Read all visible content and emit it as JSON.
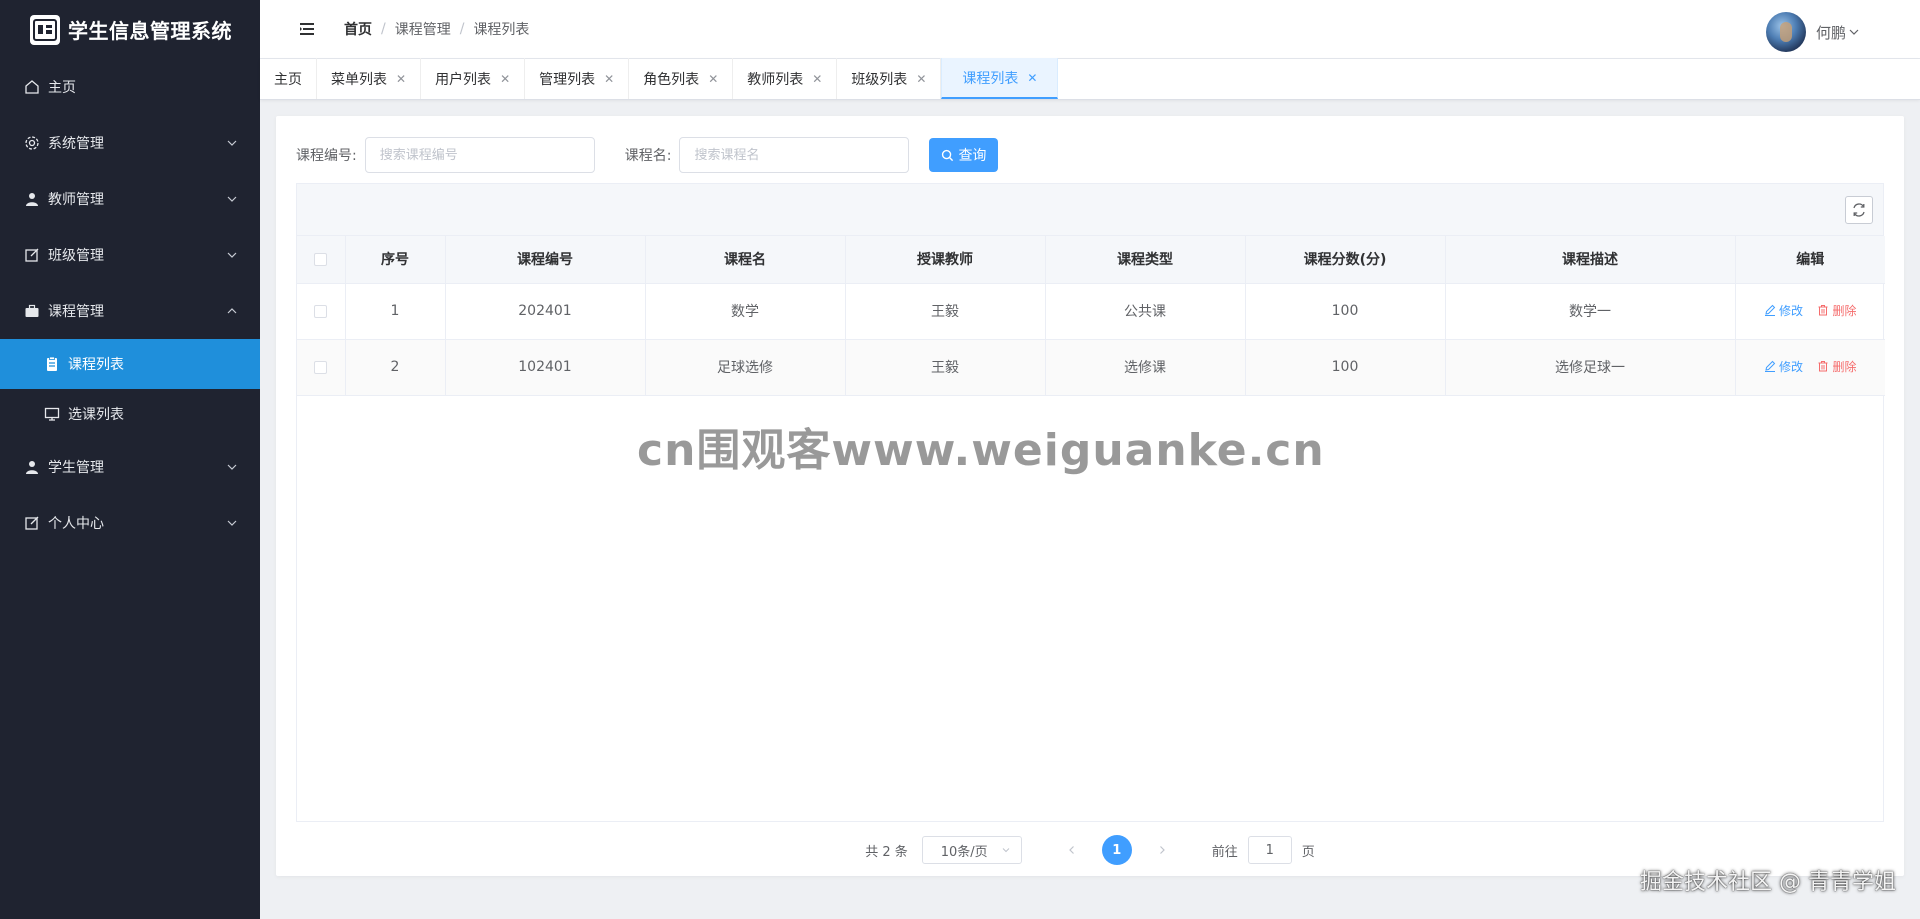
{
  "app": {
    "title": "学生信息管理系统"
  },
  "sidebar": {
    "items": [
      {
        "label": "主页",
        "icon": "home-icon"
      },
      {
        "label": "系统管理",
        "icon": "gear-icon"
      },
      {
        "label": "教师管理",
        "icon": "user-icon"
      },
      {
        "label": "班级管理",
        "icon": "edit-icon"
      },
      {
        "label": "课程管理",
        "icon": "briefcase-icon",
        "expanded": true,
        "children": [
          {
            "label": "课程列表",
            "icon": "document-icon",
            "active": true
          },
          {
            "label": "选课列表",
            "icon": "monitor-icon"
          }
        ]
      },
      {
        "label": "学生管理",
        "icon": "user-icon"
      },
      {
        "label": "个人中心",
        "icon": "edit-icon"
      }
    ]
  },
  "header": {
    "breadcrumb": [
      "首页",
      "课程管理",
      "课程列表"
    ],
    "breadcrumb_sep": "/",
    "user_name": "何鹏"
  },
  "tabs": [
    {
      "label": "主页",
      "closable": false
    },
    {
      "label": "菜单列表",
      "closable": true
    },
    {
      "label": "用户列表",
      "closable": true
    },
    {
      "label": "管理列表",
      "closable": true
    },
    {
      "label": "角色列表",
      "closable": true
    },
    {
      "label": "教师列表",
      "closable": true
    },
    {
      "label": "班级列表",
      "closable": true
    },
    {
      "label": "课程列表",
      "closable": true,
      "active": true
    }
  ],
  "search": {
    "course_no_label": "课程编号:",
    "course_no_placeholder": "搜索课程编号",
    "course_name_label": "课程名:",
    "course_name_placeholder": "搜索课程名",
    "query_button": "查询"
  },
  "table": {
    "columns": [
      "序号",
      "课程编号",
      "课程名",
      "授课教师",
      "课程类型",
      "课程分数(分)",
      "课程描述",
      "编辑"
    ],
    "rows": [
      [
        "1",
        "202401",
        "数学",
        "王毅",
        "公共课",
        "100",
        "数学一"
      ],
      [
        "2",
        "102401",
        "足球选修",
        "王毅",
        "选修课",
        "100",
        "选修足球一"
      ]
    ],
    "edit_label": "修改",
    "delete_label": "删除"
  },
  "pagination": {
    "total": "共 2 条",
    "page_size": "10条/页",
    "current_page": "1",
    "goto_prefix": "前往",
    "goto_value": "1",
    "goto_suffix": "页"
  },
  "watermarks": {
    "center": "cn围观客www.weiguanke.cn",
    "corner": "掘金技术社区 @ 青青学姐"
  },
  "colors": {
    "sidebar_bg": "#1f2330",
    "active_menu": "#1f8fdb",
    "primary": "#409eff",
    "danger": "#f56c6c"
  }
}
